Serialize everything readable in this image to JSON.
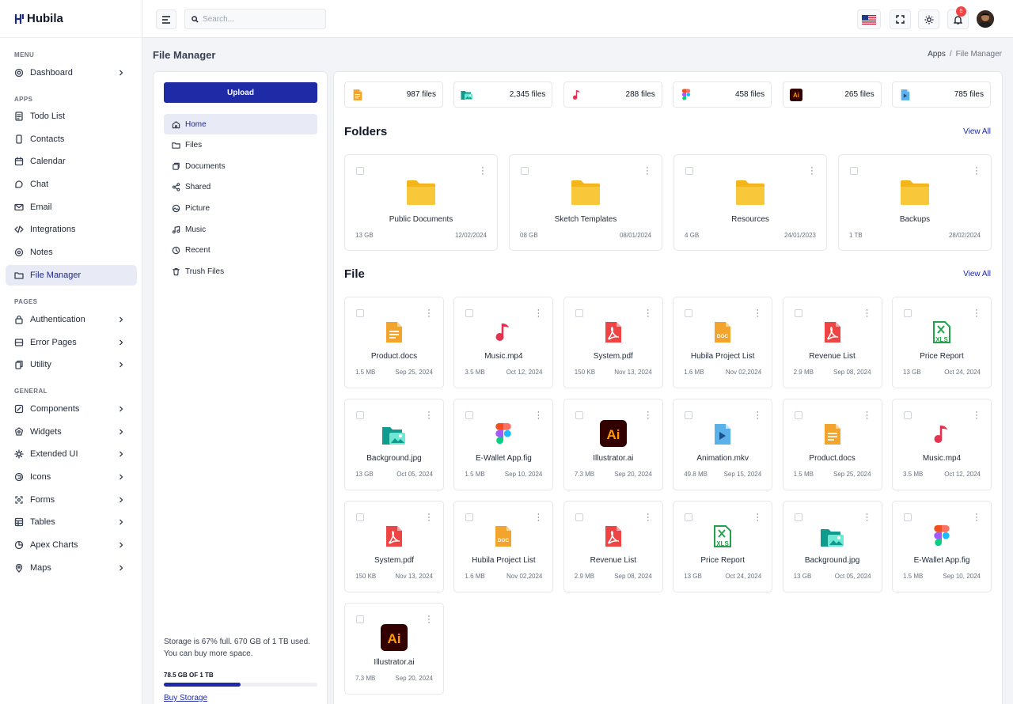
{
  "app": {
    "name": "Hubila",
    "logo_mark": "ꟸ"
  },
  "sidebar": {
    "sections": {
      "menu": "MENU",
      "apps": "APPS",
      "pages": "PAGES",
      "general": "GENERAL"
    },
    "menu": [
      {
        "label": "Dashboard",
        "icon": "dashboard-icon"
      }
    ],
    "apps": [
      {
        "label": "Todo List",
        "icon": "todo-icon"
      },
      {
        "label": "Contacts",
        "icon": "contacts-icon"
      },
      {
        "label": "Calendar",
        "icon": "calendar-icon"
      },
      {
        "label": "Chat",
        "icon": "chat-icon"
      },
      {
        "label": "Email",
        "icon": "email-icon"
      },
      {
        "label": "Integrations",
        "icon": "code-icon"
      },
      {
        "label": "Notes",
        "icon": "notes-icon"
      },
      {
        "label": "File Manager",
        "icon": "folder-icon",
        "active": true
      }
    ],
    "pages": [
      {
        "label": "Authentication",
        "icon": "lock-icon"
      },
      {
        "label": "Error Pages",
        "icon": "error-icon"
      },
      {
        "label": "Utility",
        "icon": "utility-icon"
      }
    ],
    "general": [
      {
        "label": "Components",
        "icon": "components-icon"
      },
      {
        "label": "Widgets",
        "icon": "widgets-icon"
      },
      {
        "label": "Extended UI",
        "icon": "extended-icon"
      },
      {
        "label": "Icons",
        "icon": "icons-icon"
      },
      {
        "label": "Forms",
        "icon": "forms-icon"
      },
      {
        "label": "Tables",
        "icon": "tables-icon"
      },
      {
        "label": "Apex Charts",
        "icon": "charts-icon"
      },
      {
        "label": "Maps",
        "icon": "map-icon"
      }
    ]
  },
  "topbar": {
    "search_placeholder": "Search...",
    "notification_count": "5"
  },
  "page": {
    "title": "File Manager",
    "breadcrumb": [
      "Apps",
      "/",
      "File Manager"
    ]
  },
  "file_nav": {
    "upload_label": "Upload",
    "items": [
      {
        "label": "Home",
        "icon": "home-icon",
        "active": true
      },
      {
        "label": "Files",
        "icon": "folder-icon"
      },
      {
        "label": "Documents",
        "icon": "documents-icon"
      },
      {
        "label": "Shared",
        "icon": "share-icon"
      },
      {
        "label": "Picture",
        "icon": "picture-icon"
      },
      {
        "label": "Music",
        "icon": "music-icon"
      },
      {
        "label": "Recent",
        "icon": "clock-icon"
      },
      {
        "label": "Trush Files",
        "icon": "trash-icon"
      }
    ],
    "storage_text": "Storage is 67% full. 670 GB of 1 TB used. You can buy more space.",
    "storage_used_label": "78.5 GB OF 1 TB",
    "storage_fraction": 0.5,
    "buy_label": "Buy Storage"
  },
  "stats": [
    {
      "type": "doc",
      "count": "987 files"
    },
    {
      "type": "image",
      "count": "2,345 files"
    },
    {
      "type": "music",
      "count": "288 files"
    },
    {
      "type": "figma",
      "count": "458 files"
    },
    {
      "type": "ai",
      "count": "265 files"
    },
    {
      "type": "video",
      "count": "785 files"
    }
  ],
  "folders": {
    "heading": "Folders",
    "view_all": "View All",
    "items": [
      {
        "name": "Public Documents",
        "size": "13 GB",
        "date": "12/02/2024"
      },
      {
        "name": "Sketch Templates",
        "size": "08 GB",
        "date": "08/01/2024"
      },
      {
        "name": "Resources",
        "size": "4 GB",
        "date": "24/01/2023"
      },
      {
        "name": "Backups",
        "size": "1 TB",
        "date": "28/02/2024"
      }
    ]
  },
  "files": {
    "heading": "File",
    "view_all": "View All",
    "items": [
      {
        "name": "Product.docs",
        "type": "doc",
        "size": "1.5 MB",
        "date": "Sep 25, 2024"
      },
      {
        "name": "Music.mp4",
        "type": "music",
        "size": "3.5 MB",
        "date": "Oct 12, 2024"
      },
      {
        "name": "System.pdf",
        "type": "pdf",
        "size": "150 KB",
        "date": "Nov 13, 2024"
      },
      {
        "name": "Hubila Project List",
        "type": "docfile",
        "size": "1.6 MB",
        "date": "Nov 02,2024"
      },
      {
        "name": "Revenue List",
        "type": "pdf",
        "size": "2.9 MB",
        "date": "Sep 08, 2024"
      },
      {
        "name": "Price Report",
        "type": "xls",
        "size": "13 GB",
        "date": "Oct 24, 2024"
      },
      {
        "name": "Background.jpg",
        "type": "image",
        "size": "13 GB",
        "date": "Oct 05, 2024"
      },
      {
        "name": "E-Wallet App.fig",
        "type": "figma",
        "size": "1.5 MB",
        "date": "Sep 10, 2024"
      },
      {
        "name": "Illustrator.ai",
        "type": "ai",
        "size": "7.3 MB",
        "date": "Sep 20, 2024"
      },
      {
        "name": "Animation.mkv",
        "type": "video",
        "size": "49.8 MB",
        "date": "Sep 15, 2024"
      },
      {
        "name": "Product.docs",
        "type": "doc",
        "size": "1.5 MB",
        "date": "Sep 25, 2024"
      },
      {
        "name": "Music.mp4",
        "type": "music",
        "size": "3.5 MB",
        "date": "Oct 12, 2024"
      },
      {
        "name": "System.pdf",
        "type": "pdf",
        "size": "150 KB",
        "date": "Nov 13, 2024"
      },
      {
        "name": "Hubila Project List",
        "type": "docfile",
        "size": "1.6 MB",
        "date": "Nov 02,2024"
      },
      {
        "name": "Revenue List",
        "type": "pdf",
        "size": "2.9 MB",
        "date": "Sep 08, 2024"
      },
      {
        "name": "Price Report",
        "type": "xls",
        "size": "13 GB",
        "date": "Oct 24, 2024"
      },
      {
        "name": "Background.jpg",
        "type": "image",
        "size": "13 GB",
        "date": "Oct 05, 2024"
      },
      {
        "name": "E-Wallet App.fig",
        "type": "figma",
        "size": "1.5 MB",
        "date": "Sep 10, 2024"
      },
      {
        "name": "Illustrator.ai",
        "type": "ai",
        "size": "7.3 MB",
        "date": "Sep 20, 2024"
      }
    ]
  },
  "colors": {
    "primary": "#1e2aa6",
    "active_bg": "#e8eaf6",
    "folder": "#f9c73a",
    "pdf": "#ef4444",
    "doc": "#f3a42c",
    "xls": "#22a34a",
    "image": "#0f9b8e",
    "ai_bg": "#330000",
    "ai_fg": "#ff9a00",
    "video": "#5ab0e8"
  }
}
